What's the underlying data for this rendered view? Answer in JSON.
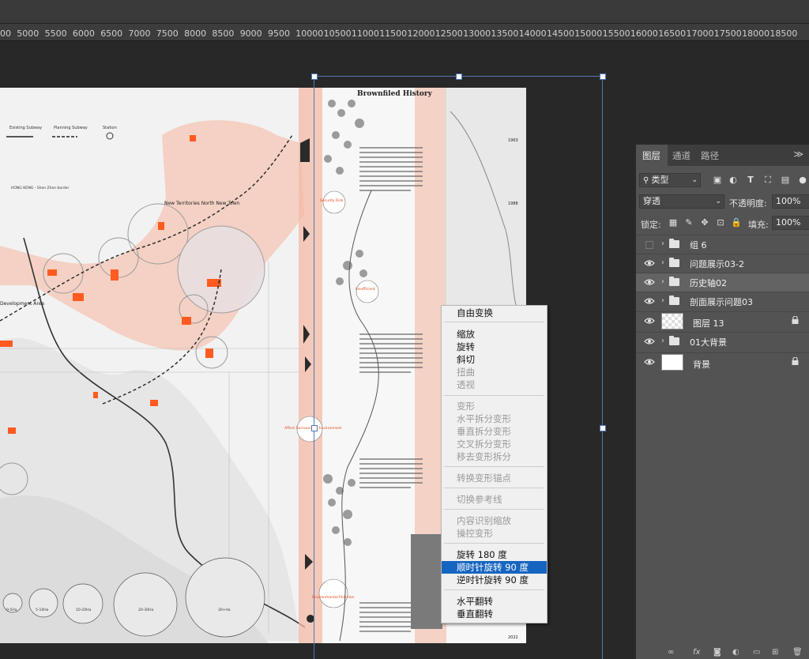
{
  "ruler": {
    "ticks": [
      "5000",
      "5000",
      "5500",
      "6000",
      "6500",
      "7000",
      "7500",
      "8000",
      "8500",
      "9000",
      "9500",
      "10000",
      "10500",
      "11000",
      "11500",
      "12000",
      "12500",
      "13000",
      "13500",
      "14000",
      "14500",
      "15000",
      "15500",
      "16000",
      "16500",
      "17000",
      "17500",
      "18000",
      "18500"
    ]
  },
  "document": {
    "poster_title": "Brownfiled History",
    "legend_existing_subway": "Existing Subway",
    "legend_planning_subway": "Planning Subway",
    "legend_station": "Station",
    "border_label": "HONG KONG - Shen Zhen border",
    "region_label_north": "New Territories North New Town",
    "region_label_dev": "Development Area",
    "year_1963": "1963",
    "year_1988": "1988",
    "year_2022": "2022",
    "labels": [
      "Insufficient",
      "Affect Surrounding Environment",
      "Environmental Pollution",
      "Security Risk"
    ],
    "scale_labels": [
      "0-5Ha",
      "5-10Ha",
      "10-20Ha",
      "20-30Ha",
      "30+Ha"
    ]
  },
  "context_menu": {
    "items": [
      {
        "label": "自由变换",
        "enabled": true,
        "selected": false
      },
      {
        "label": "缩放",
        "enabled": true,
        "selected": false
      },
      {
        "label": "旋转",
        "enabled": true,
        "selected": false
      },
      {
        "label": "斜切",
        "enabled": true,
        "selected": false
      },
      {
        "label": "扭曲",
        "enabled": false,
        "selected": false
      },
      {
        "label": "透视",
        "enabled": false,
        "selected": false
      },
      {
        "label": "变形",
        "enabled": false,
        "selected": false
      },
      {
        "label": "水平拆分变形",
        "enabled": false,
        "selected": false
      },
      {
        "label": "垂直拆分变形",
        "enabled": false,
        "selected": false
      },
      {
        "label": "交叉拆分变形",
        "enabled": false,
        "selected": false
      },
      {
        "label": "移去变形拆分",
        "enabled": false,
        "selected": false
      },
      {
        "label": "转换变形锚点",
        "enabled": false,
        "selected": false
      },
      {
        "label": "切换参考线",
        "enabled": false,
        "selected": false
      },
      {
        "label": "内容识别缩放",
        "enabled": false,
        "selected": false
      },
      {
        "label": "操控变形",
        "enabled": false,
        "selected": false
      },
      {
        "label": "旋转 180 度",
        "enabled": true,
        "selected": false
      },
      {
        "label": "顺时针旋转 90 度",
        "enabled": true,
        "selected": true
      },
      {
        "label": "逆时针旋转 90 度",
        "enabled": true,
        "selected": false
      },
      {
        "label": "水平翻转",
        "enabled": true,
        "selected": false
      },
      {
        "label": "垂直翻转",
        "enabled": true,
        "selected": false
      }
    ]
  },
  "layers_panel": {
    "tabs": [
      "图层",
      "通道",
      "路径"
    ],
    "active_tab": "图层",
    "menu_glyph": "≫",
    "filter_label": "类型",
    "blend_mode": "穿透",
    "opacity_label": "不透明度:",
    "opacity_value": "100%",
    "lock_label": "锁定:",
    "fill_label": "填充:",
    "fill_value": "100%",
    "layers": [
      {
        "name": "组 6",
        "type": "group",
        "visible": false,
        "highlighted": false,
        "locked": false
      },
      {
        "name": "问题展示03-2",
        "type": "group",
        "visible": true,
        "highlighted": false,
        "locked": false
      },
      {
        "name": "历史轴02",
        "type": "group",
        "visible": true,
        "highlighted": true,
        "locked": false
      },
      {
        "name": "剖面展示问题03",
        "type": "group",
        "visible": true,
        "highlighted": false,
        "locked": false
      },
      {
        "name": "图层 13",
        "type": "layer-checker",
        "visible": true,
        "highlighted": false,
        "locked": true
      },
      {
        "name": "01大背景",
        "type": "group",
        "visible": true,
        "highlighted": false,
        "locked": false
      },
      {
        "name": "背景",
        "type": "layer-white",
        "visible": true,
        "highlighted": false,
        "locked": true
      }
    ],
    "bottom_icons": [
      "link-icon",
      "fx-icon",
      "mask-icon",
      "adjustment-icon",
      "group-icon",
      "new-layer-icon",
      "trash-icon"
    ]
  },
  "colors": {
    "accent_selected": "#1565c0",
    "transform_box": "#4f79b6",
    "map_orange": "#ff5a1f",
    "map_pink": "#f4b9a5"
  }
}
